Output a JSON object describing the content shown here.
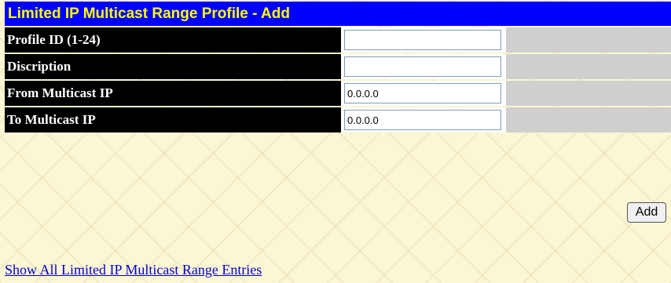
{
  "header": {
    "title": "Limited IP Multicast Range Profile - Add"
  },
  "form": {
    "profile_id": {
      "label": "Profile ID (1-24)",
      "value": ""
    },
    "description": {
      "label": "Discription",
      "value": ""
    },
    "from_ip": {
      "label": "From Multicast IP",
      "value": "0.0.0.0"
    },
    "to_ip": {
      "label": "To Multicast IP",
      "value": "0.0.0.0"
    }
  },
  "actions": {
    "add_label": "Add"
  },
  "links": {
    "show_all": "Show All Limited IP Multicast Range Entries"
  },
  "colors": {
    "header_bg": "#0000ff",
    "header_text": "#ffff00",
    "label_bg": "#000000",
    "label_text": "#ffffff",
    "pad_bg": "#cfcfcf",
    "page_bg": "#fbf6d4",
    "link": "#0000cc"
  }
}
